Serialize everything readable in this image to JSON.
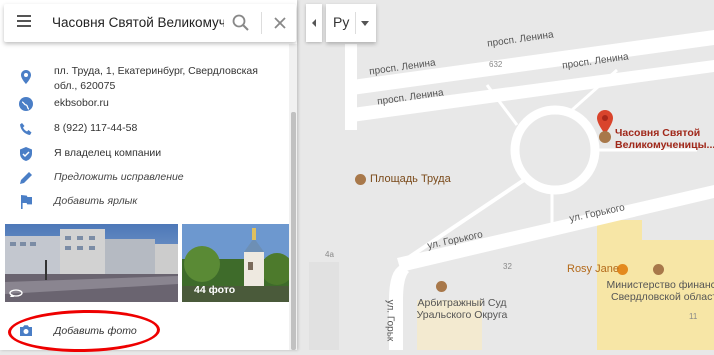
{
  "search": {
    "value": "Часовня Святой Великомучени"
  },
  "language": {
    "current": "Ру"
  },
  "info": {
    "address": "пл. Труда, 1, Екатеринбург, Свердловская обл., 620075",
    "website": "ekbsobor.ru",
    "phone": "8 (922) 117-44-58",
    "owner": "Я владелец компании",
    "suggest_edit": "Предложить исправление",
    "add_label": "Добавить ярлык"
  },
  "photos": {
    "count_label": "44 фото"
  },
  "add_photo": {
    "label": "Добавить фото"
  },
  "map": {
    "streets": {
      "lenina1": "просп. Ленина",
      "lenina2": "просп. Ленина",
      "lenina3": "просп. Ленина",
      "lenina4": "просп. Ленина",
      "gorkogo1": "ул. Горького",
      "gorkogo2": "ул. Горького",
      "gorkogo3": "ул. Горьк"
    },
    "numbers": {
      "n632": "632",
      "n4a": "4а",
      "n32": "32",
      "n11": "11"
    },
    "places": {
      "chapel": "Часовня Святой Великомученицы...",
      "square": "Площадь Труда",
      "rosy": "Rosy Jane",
      "ministry": "Министерство финансов Свердловской области",
      "court": "Арбитражный Суд Уральского Округа"
    },
    "colors": {
      "road": "#ffffff",
      "ground": "#e8e8e8",
      "building": "#f7e6a6",
      "pin": "#d9442c",
      "poi": "#a8784a"
    }
  }
}
